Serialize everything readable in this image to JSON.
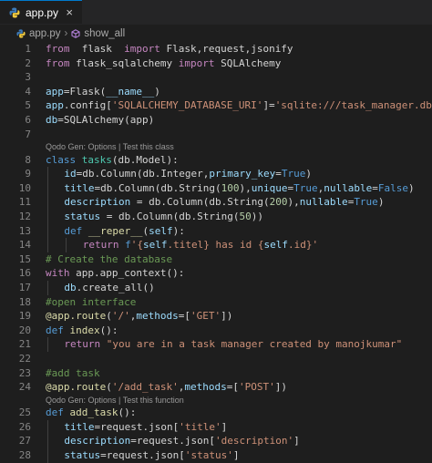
{
  "tab": {
    "label": "app.py",
    "close": "×"
  },
  "breadcrumb": {
    "file": "app.py",
    "separator": "›",
    "symbol": "show_all"
  },
  "codelens": {
    "class_lens": "Qodo Gen: Options | Test this class",
    "func_lens": "Qodo Gen: Options | Test this function"
  },
  "lines": [
    {
      "n": "1",
      "tokens": [
        [
          "kw",
          "from"
        ],
        [
          "",
          "  flask  "
        ],
        [
          "kw",
          "import"
        ],
        [
          "",
          " Flask,request,jsonify"
        ]
      ]
    },
    {
      "n": "2",
      "tokens": [
        [
          "kw",
          "from"
        ],
        [
          "",
          " flask_sqlalchemy "
        ],
        [
          "kw",
          "import"
        ],
        [
          "",
          " SQLAlchemy"
        ]
      ]
    },
    {
      "n": "3",
      "tokens": []
    },
    {
      "n": "4",
      "tokens": [
        [
          "var",
          "app"
        ],
        [
          "",
          "=Flask("
        ],
        [
          "var",
          "__name__"
        ],
        [
          "",
          ")"
        ]
      ]
    },
    {
      "n": "5",
      "tokens": [
        [
          "var",
          "app"
        ],
        [
          "",
          ".config["
        ],
        [
          "str",
          "'SQLALCHEMY_DATABASE_URI'"
        ],
        [
          "",
          "]="
        ],
        [
          "str",
          "'sqlite:///task_manager.db'"
        ]
      ]
    },
    {
      "n": "6",
      "tokens": [
        [
          "var",
          "db"
        ],
        [
          "",
          "=SQLAlchemy(app)"
        ]
      ]
    },
    {
      "n": "7",
      "tokens": []
    },
    {
      "n": "8",
      "tokens": [
        [
          "kwb",
          "class"
        ],
        [
          "",
          " "
        ],
        [
          "cls",
          "tasks"
        ],
        [
          "",
          "(db.Model):"
        ]
      ]
    },
    {
      "n": "9",
      "indent": 1,
      "tokens": [
        [
          "var",
          "id"
        ],
        [
          "",
          "=db.Column(db.Integer,"
        ],
        [
          "var",
          "primary_key"
        ],
        [
          "",
          "="
        ],
        [
          "kwb",
          "True"
        ],
        [
          "",
          ")"
        ]
      ]
    },
    {
      "n": "10",
      "indent": 1,
      "tokens": [
        [
          "var",
          "title"
        ],
        [
          "",
          "=db.Column(db.String("
        ],
        [
          "num",
          "100"
        ],
        [
          "",
          "),"
        ],
        [
          "var",
          "unique"
        ],
        [
          "",
          "="
        ],
        [
          "kwb",
          "True"
        ],
        [
          "",
          ","
        ],
        [
          "var",
          "nullable"
        ],
        [
          "",
          "="
        ],
        [
          "kwb",
          "False"
        ],
        [
          "",
          ")"
        ]
      ]
    },
    {
      "n": "11",
      "indent": 1,
      "tokens": [
        [
          "var",
          "description"
        ],
        [
          "",
          " = db.Column(db.String("
        ],
        [
          "num",
          "200"
        ],
        [
          "",
          "),"
        ],
        [
          "var",
          "nullable"
        ],
        [
          "",
          "="
        ],
        [
          "kwb",
          "True"
        ],
        [
          "",
          ")"
        ]
      ]
    },
    {
      "n": "12",
      "indent": 1,
      "tokens": [
        [
          "var",
          "status"
        ],
        [
          "",
          " = db.Column(db.String("
        ],
        [
          "num",
          "50"
        ],
        [
          "",
          "))"
        ]
      ]
    },
    {
      "n": "13",
      "indent": 1,
      "tokens": [
        [
          "kwb",
          "def"
        ],
        [
          "",
          " "
        ],
        [
          "fn",
          "__reper__"
        ],
        [
          "",
          "("
        ],
        [
          "var",
          "self"
        ],
        [
          "",
          "):"
        ]
      ]
    },
    {
      "n": "14",
      "indent": 2,
      "tokens": [
        [
          "kw",
          "return"
        ],
        [
          "",
          " "
        ],
        [
          "fkw",
          "f"
        ],
        [
          "str",
          "'{"
        ],
        [
          "var",
          "self"
        ],
        [
          "str",
          ".titel} has id {"
        ],
        [
          "var",
          "self"
        ],
        [
          "str",
          ".id}'"
        ]
      ]
    },
    {
      "n": "15",
      "tokens": [
        [
          "cm",
          "# Create the database"
        ]
      ]
    },
    {
      "n": "16",
      "tokens": [
        [
          "kw",
          "with"
        ],
        [
          "",
          " app.app_context():"
        ]
      ]
    },
    {
      "n": "17",
      "indent": 1,
      "tokens": [
        [
          "var",
          "db"
        ],
        [
          "",
          ".create_all()"
        ]
      ]
    },
    {
      "n": "18",
      "tokens": [
        [
          "cm",
          "#open interface"
        ]
      ]
    },
    {
      "n": "19",
      "tokens": [
        [
          "dec",
          "@app.route"
        ],
        [
          "",
          "("
        ],
        [
          "str",
          "'/'"
        ],
        [
          "",
          ","
        ],
        [
          "var",
          "methods"
        ],
        [
          "",
          "=["
        ],
        [
          "str",
          "'GET'"
        ],
        [
          "",
          "])"
        ]
      ]
    },
    {
      "n": "20",
      "tokens": [
        [
          "kwb",
          "def"
        ],
        [
          "",
          " "
        ],
        [
          "fn",
          "index"
        ],
        [
          "",
          "():"
        ]
      ]
    },
    {
      "n": "21",
      "indent": 1,
      "tokens": [
        [
          "kw",
          "return"
        ],
        [
          "",
          " "
        ],
        [
          "str",
          "\"you are in a task manager created by manojkumar\""
        ]
      ]
    },
    {
      "n": "22",
      "tokens": []
    },
    {
      "n": "23",
      "tokens": [
        [
          "cm",
          "#add task"
        ]
      ]
    },
    {
      "n": "24",
      "tokens": [
        [
          "dec",
          "@app.route"
        ],
        [
          "",
          "("
        ],
        [
          "str",
          "'/add_task'"
        ],
        [
          "",
          ","
        ],
        [
          "var",
          "methods"
        ],
        [
          "",
          "=["
        ],
        [
          "str",
          "'POST'"
        ],
        [
          "",
          "])"
        ]
      ]
    },
    {
      "n": "25",
      "tokens": [
        [
          "kwb",
          "def"
        ],
        [
          "",
          " "
        ],
        [
          "fn",
          "add_task"
        ],
        [
          "",
          "():"
        ]
      ]
    },
    {
      "n": "26",
      "indent": 1,
      "tokens": [
        [
          "var",
          "title"
        ],
        [
          "",
          "=request.json["
        ],
        [
          "str",
          "'title'"
        ],
        [
          "",
          "]"
        ]
      ]
    },
    {
      "n": "27",
      "indent": 1,
      "tokens": [
        [
          "var",
          "description"
        ],
        [
          "",
          "=request.json["
        ],
        [
          "str",
          "'description'"
        ],
        [
          "",
          "]"
        ]
      ]
    },
    {
      "n": "28",
      "indent": 1,
      "tokens": [
        [
          "var",
          "status"
        ],
        [
          "",
          "=request.json["
        ],
        [
          "str",
          "'status'"
        ],
        [
          "",
          "]"
        ]
      ]
    }
  ],
  "codelens_before_line": {
    "8": "class_lens",
    "25": "func_lens"
  },
  "colors": {
    "accent": "#007acc",
    "background": "#1e1e1e"
  }
}
